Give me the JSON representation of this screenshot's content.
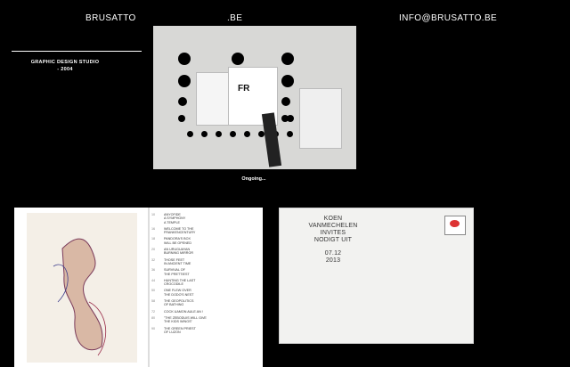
{
  "header": {
    "logo": "BRUSATTO",
    "domain_suffix": ".BE",
    "email": "INFO@BRUSATTO.BE"
  },
  "sidebar": {
    "tagline": "GRAPHIC DESIGN STUDIO\n- 2004"
  },
  "feature": {
    "caption": "Ongoing..."
  },
  "book": {
    "toc": [
      {
        "num": "10",
        "title": "ANYOFIDE\nA SYMPHONY\nA TEMPLE"
      },
      {
        "num": "16",
        "title": "WELCOME TO THE\nFRANKENCENTURY"
      },
      {
        "num": "18",
        "title": "PANDORA'S BOX\nWILL BE OPENED"
      },
      {
        "num": "20",
        "title": "AN URUGUAYAN\nBURNING MIRROR"
      },
      {
        "num": "32",
        "title": "THOSE FEET\nIN ANCIENT TIME"
      },
      {
        "num": "36",
        "title": "SURVIVAL OF\nTHE PRETTIEST"
      },
      {
        "num": "44",
        "title": "HUNTING THE LAST\nCROCODILE"
      },
      {
        "num": "50",
        "title": "ONE FLEW OVER\nTHE DODO'S NEST"
      },
      {
        "num": "58",
        "title": "THE GEOPOLITICS\nOF BATHING"
      },
      {
        "num": "72",
        "title": "COCK UAMON AULE AN !"
      },
      {
        "num": "80",
        "title": "\"THE ZEBODUIS WILL GIVE\nTHE KIDS WINGS\""
      },
      {
        "num": "90",
        "title": "THE GREEN PRIEST\nOF LUZON"
      }
    ]
  },
  "envelope": {
    "line1": "KOEN",
    "line2": "VANMECHELEN",
    "line3": "INVITES",
    "line4": "NODIGT UIT",
    "date": "07.12",
    "year": "2013"
  }
}
